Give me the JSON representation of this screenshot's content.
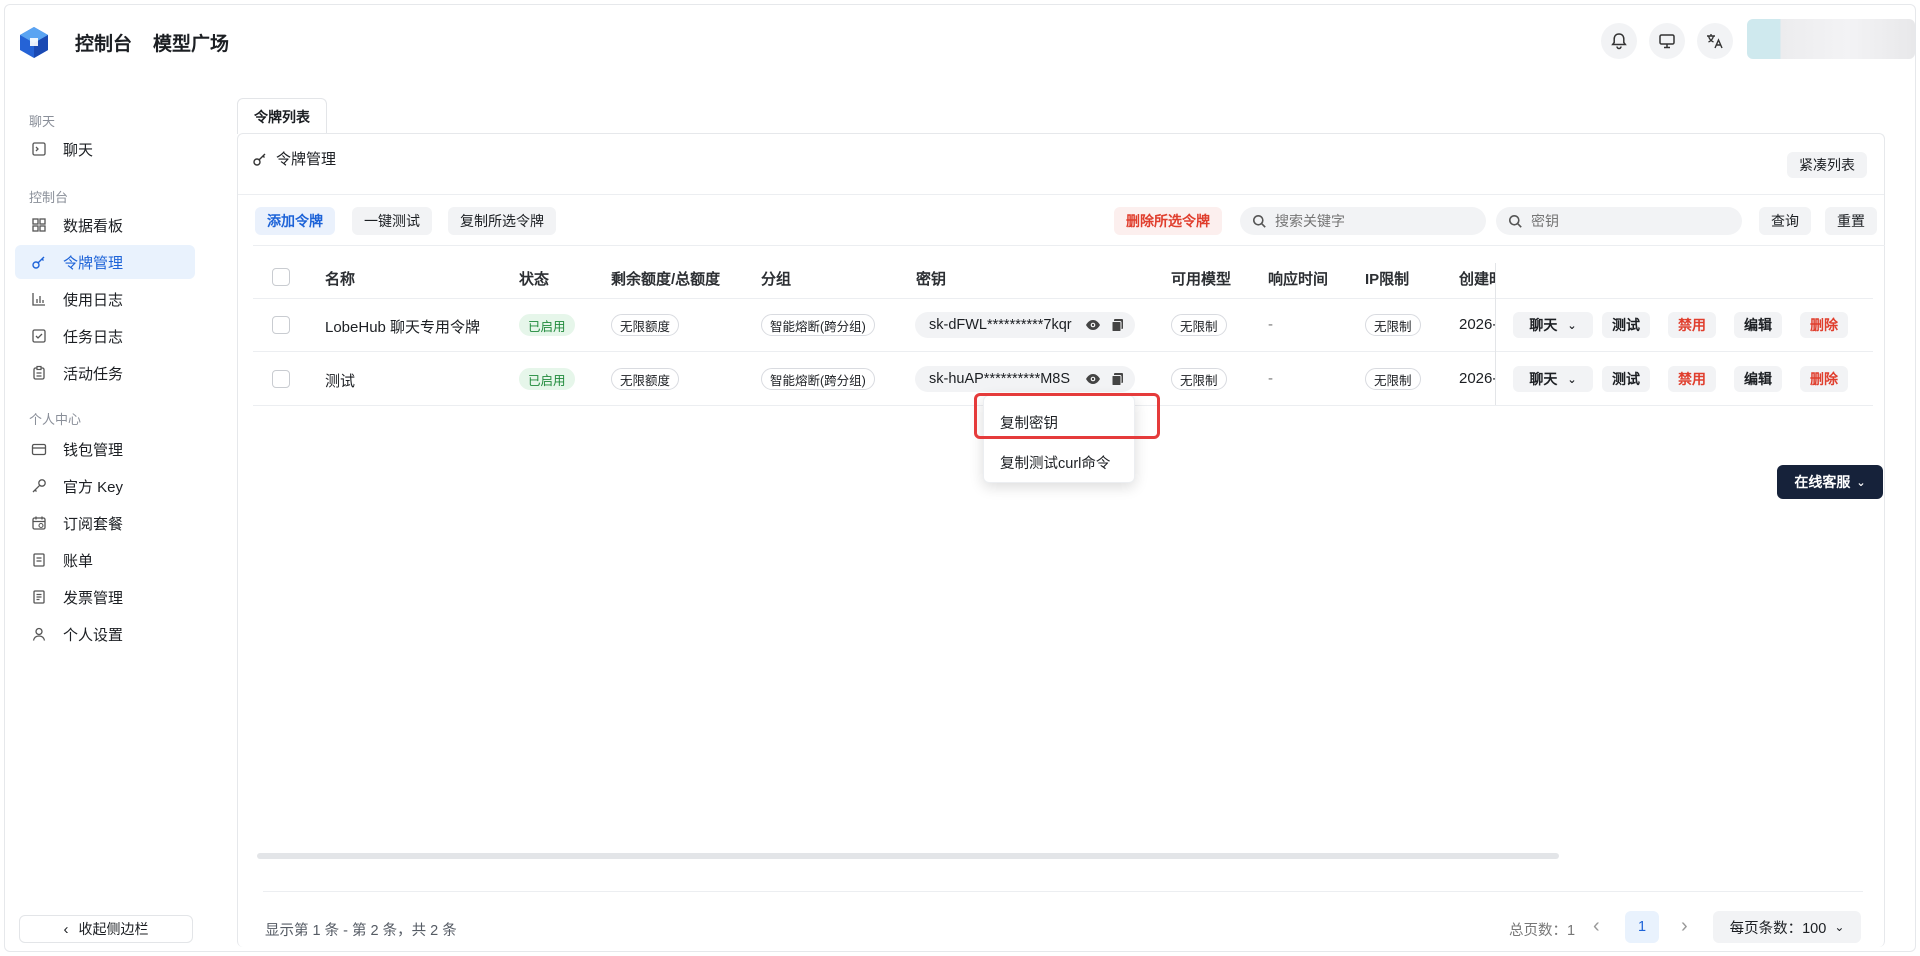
{
  "header": {
    "nav": [
      "控制台",
      "模型广场"
    ]
  },
  "sidebar": {
    "sections": [
      {
        "title": "聊天",
        "items": [
          {
            "label": "聊天",
            "icon": "chat-icon"
          }
        ]
      },
      {
        "title": "控制台",
        "items": [
          {
            "label": "数据看板",
            "icon": "dashboard-icon"
          },
          {
            "label": "令牌管理",
            "icon": "key-icon",
            "active": true
          },
          {
            "label": "使用日志",
            "icon": "chart-icon"
          },
          {
            "label": "任务日志",
            "icon": "checklist-icon"
          },
          {
            "label": "活动任务",
            "icon": "clipboard-icon"
          }
        ]
      },
      {
        "title": "个人中心",
        "items": [
          {
            "label": "钱包管理",
            "icon": "wallet-icon"
          },
          {
            "label": "官方 Key",
            "icon": "key-outline-icon"
          },
          {
            "label": "订阅套餐",
            "icon": "calendar-icon"
          },
          {
            "label": "账单",
            "icon": "bill-icon"
          },
          {
            "label": "发票管理",
            "icon": "invoice-icon"
          },
          {
            "label": "个人设置",
            "icon": "user-icon"
          }
        ]
      }
    ],
    "collapse_label": "收起侧边栏"
  },
  "main": {
    "tab_label": "令牌列表",
    "panel_title": "令牌管理",
    "compact_label": "紧凑列表",
    "toolbar": {
      "add": "添加令牌",
      "test_all": "一键测试",
      "copy_selected": "复制所选令牌",
      "delete_selected": "删除所选令牌",
      "search_placeholder": "搜索关键字",
      "key_placeholder": "密钥",
      "query": "查询",
      "reset": "重置"
    },
    "columns": [
      "名称",
      "状态",
      "剩余额度/总额度",
      "分组",
      "密钥",
      "可用模型",
      "响应时间",
      "IP限制",
      "创建时"
    ],
    "rows": [
      {
        "name": "LobeHub 聊天专用令牌",
        "status": "已启用",
        "quota": "无限额度",
        "group": "智能熔断(跨分组)",
        "key": "sk-dFWL**********7kqr",
        "models": "无限制",
        "latency": "-",
        "ip": "无限制",
        "created": "2026-"
      },
      {
        "name": "测试",
        "status": "已启用",
        "quota": "无限额度",
        "group": "智能熔断(跨分组)",
        "key": "sk-huAP**********M8S",
        "models": "无限制",
        "latency": "-",
        "ip": "无限制",
        "created": "2026-"
      }
    ],
    "row_actions": {
      "chat": "聊天",
      "test": "测试",
      "disable": "禁用",
      "edit": "编辑",
      "delete": "删除"
    },
    "copy_menu": [
      "复制密钥",
      "复制测试curl命令"
    ],
    "service_label": "在线客服",
    "footer": {
      "summary": "显示第 1 条 - 第 2 条，共 2 条",
      "total_pages": "总页数：1",
      "current_page": "1",
      "page_size": "每页条数：100"
    }
  },
  "colors": {
    "accent": "#1d63d8",
    "danger": "#e03e2d",
    "success": "#1f8a3b"
  }
}
